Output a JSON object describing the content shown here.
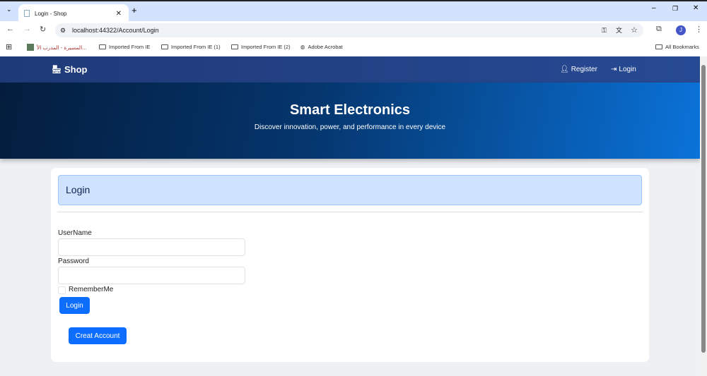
{
  "browser": {
    "tab_title": "Login - Shop",
    "url": "localhost:44322/Account/Login",
    "bookmarks": [
      "المسيرة - المدرب الأ...",
      "Imported From IE",
      "Imported From IE (1)",
      "Imported From IE (2)",
      "Adobe Acrobat"
    ],
    "all_bookmarks": "All Bookmarks",
    "profile_initial": "J"
  },
  "nav": {
    "brand": "Shop",
    "register": "Register",
    "login": "Login"
  },
  "hero": {
    "title": "Smart Electronics",
    "subtitle": "Discover innovation, power, and performance in every device"
  },
  "form": {
    "heading": "Login",
    "username_label": "UserName",
    "username_value": "",
    "password_label": "Password",
    "password_value": "",
    "remember_label": "RememberMe",
    "remember_checked": false,
    "login_button": "Login",
    "create_button": "Creat Account"
  }
}
